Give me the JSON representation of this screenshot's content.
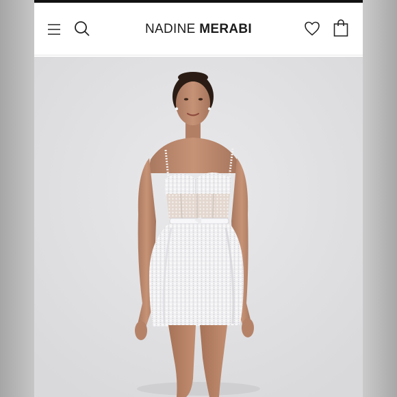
{
  "header": {
    "brand_part1": "NADINE",
    "brand_part2": "MERABI"
  },
  "icons": {
    "menu": "menu-icon",
    "search": "search-icon",
    "wishlist": "heart-icon",
    "bag": "shopping-bag-icon"
  },
  "colors": {
    "top_bar": "#111111",
    "header_bg": "#ffffff",
    "hero_bg": "#e1e1e3",
    "text": "#1a1a1a"
  }
}
